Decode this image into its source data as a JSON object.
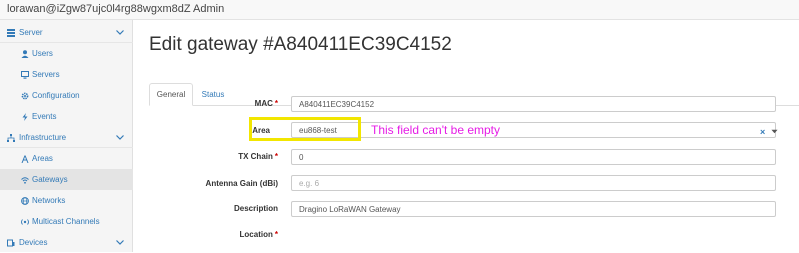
{
  "topbar": {
    "user": "lorawan@iZgw87ujc0l4rg88wgxm8dZ Admin"
  },
  "sidebar": {
    "sections": [
      {
        "label": "Server",
        "icon": "server-stack-icon"
      },
      {
        "label": "Infrastructure",
        "icon": "network-tree-icon"
      },
      {
        "label": "Devices",
        "icon": "devices-icon"
      }
    ],
    "server_items": [
      {
        "label": "Users",
        "icon": "user-icon"
      },
      {
        "label": "Servers",
        "icon": "monitor-icon"
      },
      {
        "label": "Configuration",
        "icon": "gear-icon"
      },
      {
        "label": "Events",
        "icon": "bolt-icon"
      }
    ],
    "infra_items": [
      {
        "label": "Areas",
        "icon": "tower-icon"
      },
      {
        "label": "Gateways",
        "icon": "wifi-icon"
      },
      {
        "label": "Networks",
        "icon": "globe-icon"
      },
      {
        "label": "Multicast Channels",
        "icon": "broadcast-icon"
      }
    ],
    "active_item": "Gateways"
  },
  "main": {
    "title": "Edit gateway #A840411EC39C4152",
    "tabs": [
      {
        "label": "General"
      },
      {
        "label": "Status"
      }
    ],
    "form": {
      "mac": {
        "label": "MAC",
        "required": "*",
        "value": "A840411EC39C4152"
      },
      "area": {
        "label": "Area",
        "value": "eu868-test",
        "clear": "×"
      },
      "tx_chain": {
        "label": "TX Chain",
        "required": "*",
        "value": "0"
      },
      "antenna_gain": {
        "label": "Antenna Gain (dBi)",
        "placeholder": "e.g. 6"
      },
      "description": {
        "label": "Description",
        "value": "Dragino LoRaWAN Gateway"
      },
      "location": {
        "label": "Location",
        "required": "*"
      }
    },
    "annotation": {
      "message": "This field can't be empty"
    }
  },
  "colors": {
    "link": "#337ab7",
    "highlight": "#f2e600",
    "annotation": "#e61ce6",
    "required": "#cc0000"
  }
}
